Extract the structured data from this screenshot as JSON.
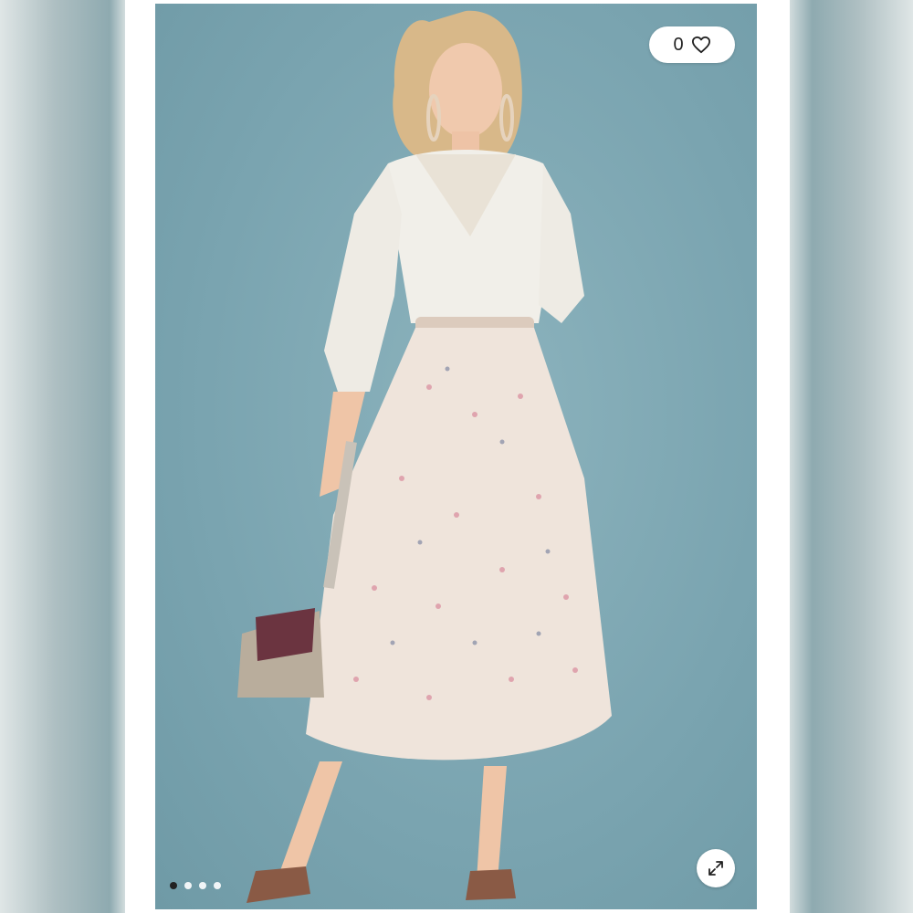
{
  "like": {
    "count": "0",
    "icon": "heart-icon"
  },
  "gallery": {
    "total_images": 4,
    "active_index": 0
  },
  "expand": {
    "icon": "expand-icon"
  },
  "colors": {
    "backdrop": "#7fa8b4",
    "blouse": "#f1efe9",
    "skirt": "#efe4db",
    "bag": "#6b3440",
    "active_dot": "#222222"
  }
}
